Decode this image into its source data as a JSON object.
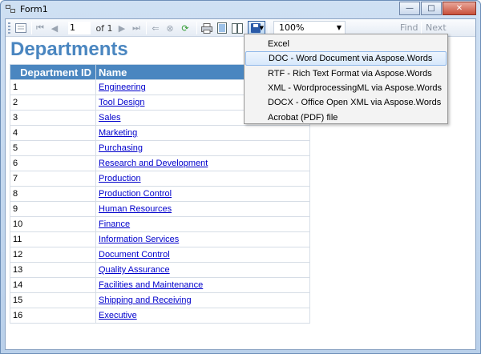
{
  "window": {
    "title": "Form1",
    "minimize": "—",
    "maximize": "□",
    "close": "✕"
  },
  "toolbar": {
    "page_current": "1",
    "page_of": "of 1",
    "zoom": "100%",
    "find": "Find",
    "next": "Next",
    "icons": [
      "document-map-icon",
      "first-page-icon",
      "prev-page-icon",
      "next-page-icon",
      "last-page-icon",
      "back-icon",
      "stop-icon",
      "refresh-icon",
      "print-icon",
      "print-layout-icon",
      "page-setup-icon",
      "save-icon"
    ]
  },
  "report": {
    "title": "Departments",
    "columns": [
      "Department ID",
      "Name"
    ],
    "rows": [
      [
        "1",
        "Engineering"
      ],
      [
        "2",
        "Tool Design"
      ],
      [
        "3",
        "Sales"
      ],
      [
        "4",
        "Marketing"
      ],
      [
        "5",
        "Purchasing"
      ],
      [
        "6",
        "Research and Development"
      ],
      [
        "7",
        "Production"
      ],
      [
        "8",
        "Production Control"
      ],
      [
        "9",
        "Human Resources"
      ],
      [
        "10",
        "Finance"
      ],
      [
        "11",
        "Information Services"
      ],
      [
        "12",
        "Document Control"
      ],
      [
        "13",
        "Quality Assurance"
      ],
      [
        "14",
        "Facilities and Maintenance"
      ],
      [
        "15",
        "Shipping and Receiving"
      ],
      [
        "16",
        "Executive"
      ]
    ]
  },
  "export_menu": {
    "items": [
      "Excel",
      "DOC - Word Document via Aspose.Words",
      "RTF - Rich Text Format via Aspose.Words",
      "XML - WordprocessingML via Aspose.Words",
      "DOCX - Office Open XML via Aspose.Words",
      "Acrobat (PDF) file"
    ],
    "highlighted_index": 1
  }
}
